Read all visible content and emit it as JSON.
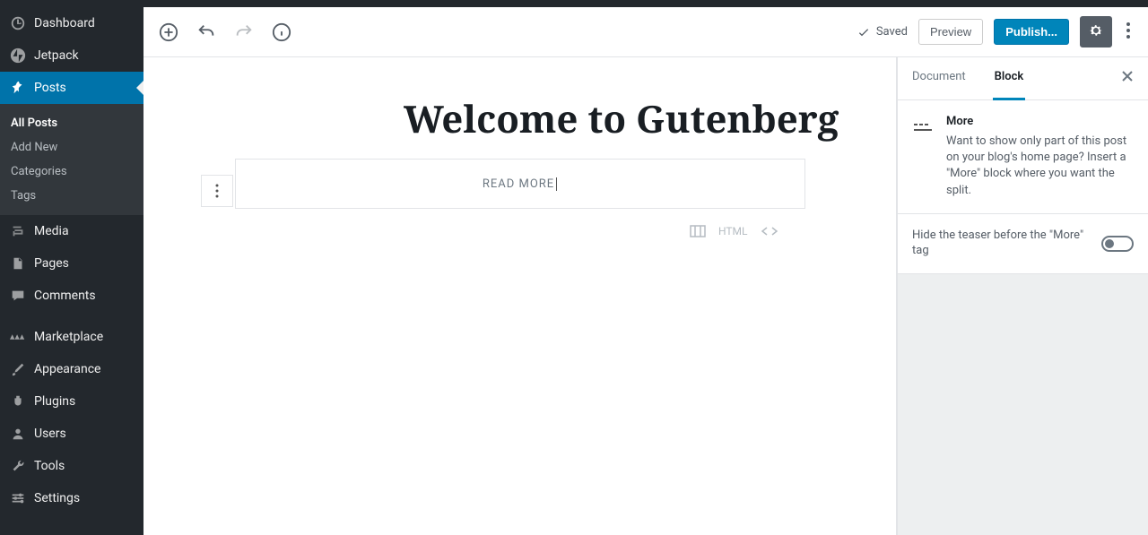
{
  "sidebar": {
    "items": [
      {
        "label": "Dashboard"
      },
      {
        "label": "Jetpack"
      },
      {
        "label": "Posts"
      },
      {
        "label": "Media"
      },
      {
        "label": "Pages"
      },
      {
        "label": "Comments"
      },
      {
        "label": "Marketplace"
      },
      {
        "label": "Appearance"
      },
      {
        "label": "Plugins"
      },
      {
        "label": "Users"
      },
      {
        "label": "Tools"
      },
      {
        "label": "Settings"
      }
    ],
    "posts_submenu": [
      {
        "label": "All Posts"
      },
      {
        "label": "Add New"
      },
      {
        "label": "Categories"
      },
      {
        "label": "Tags"
      }
    ]
  },
  "toolbar": {
    "saved_label": "Saved",
    "preview_label": "Preview",
    "publish_label": "Publish..."
  },
  "editor": {
    "title": "Welcome to Gutenberg",
    "more_text": "READ MORE",
    "html_label": "HTML"
  },
  "settings": {
    "tabs": {
      "document": "Document",
      "block": "Block"
    },
    "block": {
      "name": "More",
      "description": "Want to show only part of this post on your blog's home page? Insert a \"More\" block where you want the split."
    },
    "toggle_label": "Hide the teaser before the \"More\" tag"
  }
}
